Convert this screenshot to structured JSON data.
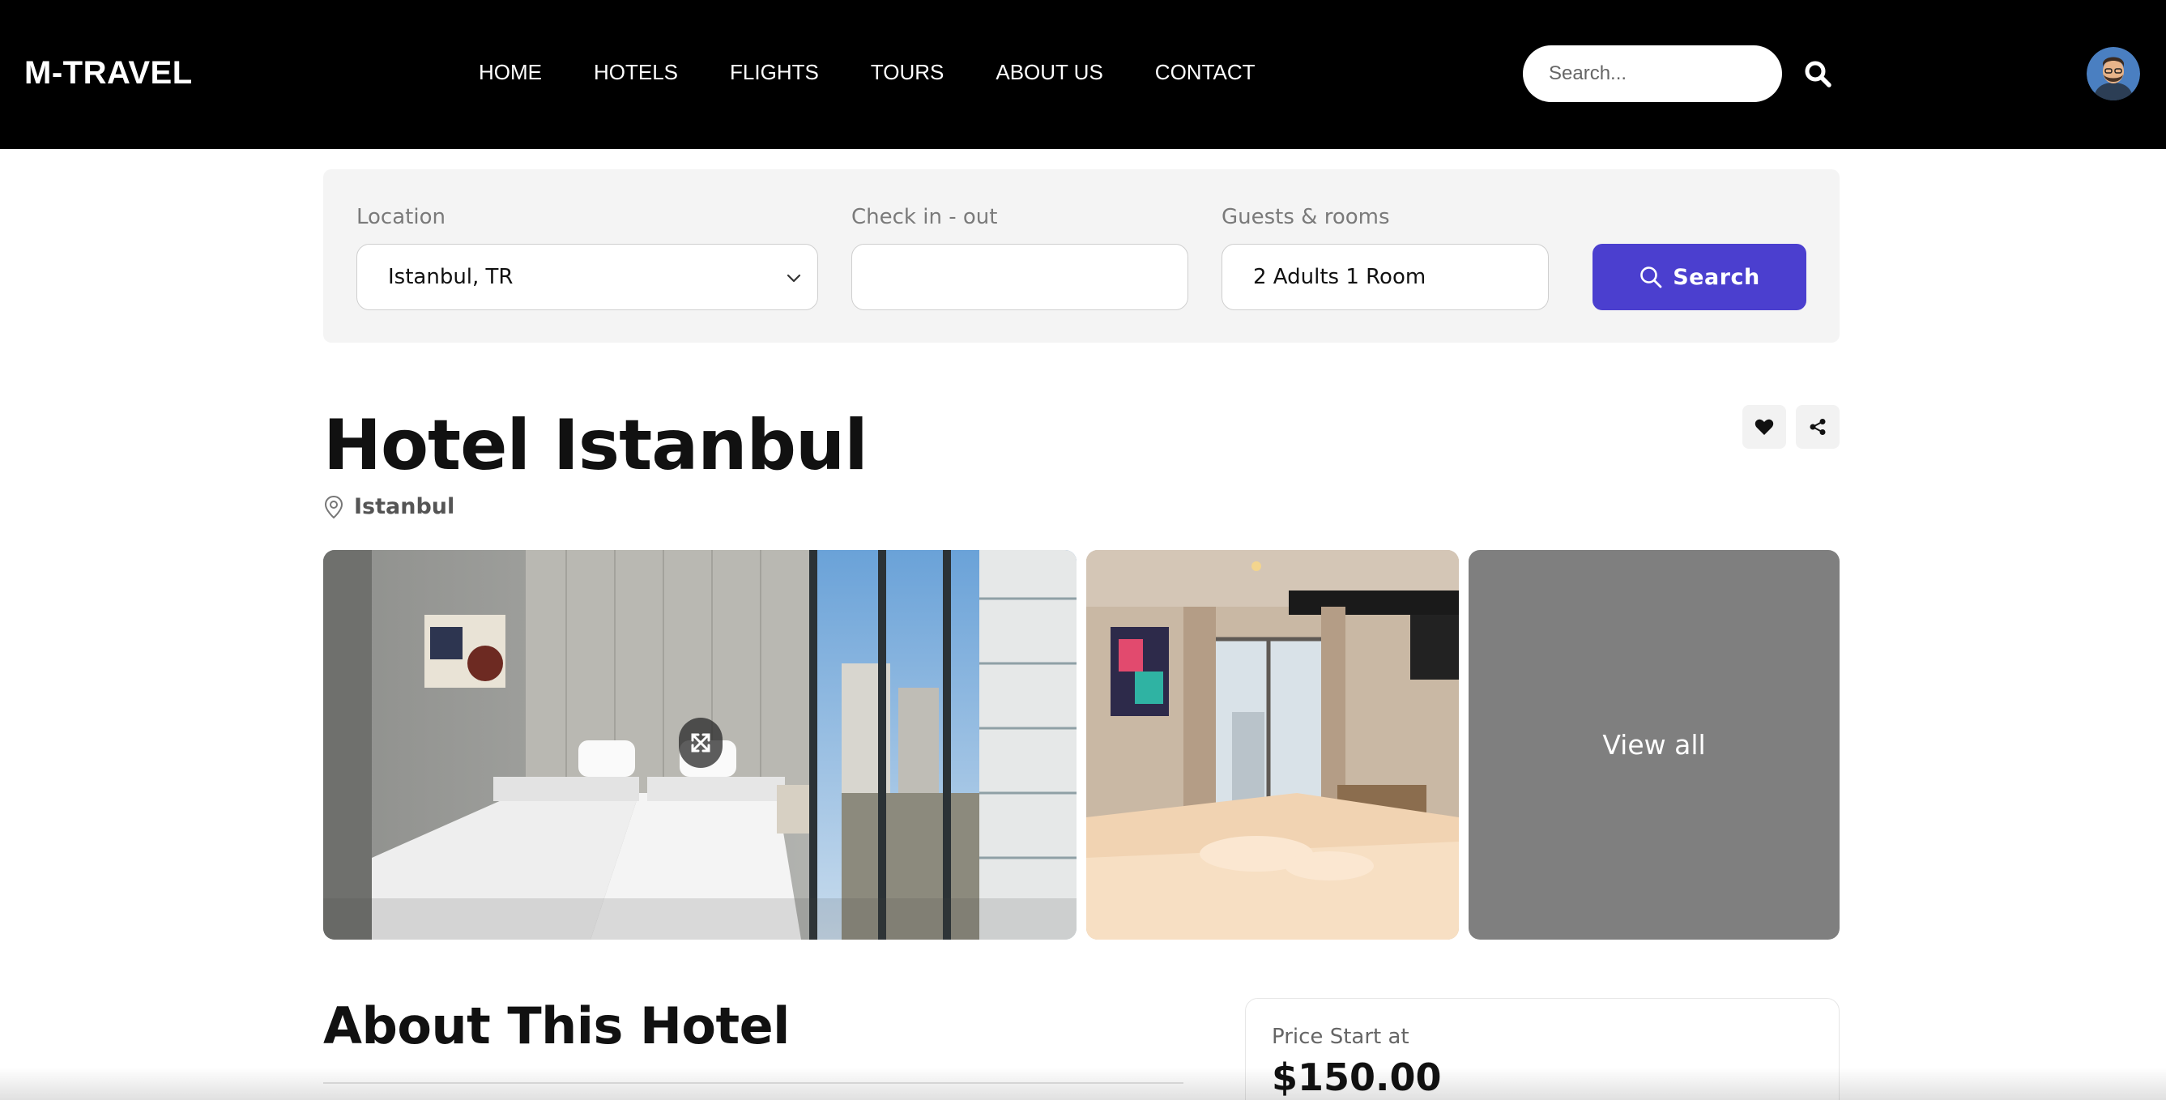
{
  "header": {
    "logo": "M-TRAVEL",
    "nav": [
      "HOME",
      "HOTELS",
      "FLIGHTS",
      "TOURS",
      "ABOUT US",
      "CONTACT"
    ],
    "search_placeholder": "Search..."
  },
  "booking": {
    "location_label": "Location",
    "location_value": "Istanbul, TR",
    "checkin_label": "Check in - out",
    "checkin_value": "",
    "guests_label": "Guests & rooms",
    "guests_value": "2 Adults 1 Room",
    "search_label": "Search",
    "accent_color": "#4b3fcf"
  },
  "hotel": {
    "title": "Hotel Istanbul",
    "location": "Istanbul"
  },
  "gallery": {
    "view_all_label": "View all"
  },
  "about": {
    "title": "About This Hotel"
  },
  "price": {
    "label": "Price Start at",
    "value": "$150.00"
  },
  "icons": {
    "search": "search-icon",
    "heart": "heart-icon",
    "share": "share-icon",
    "location": "location-pin-icon",
    "expand": "expand-icon",
    "chevron": "chevron-down-icon"
  }
}
